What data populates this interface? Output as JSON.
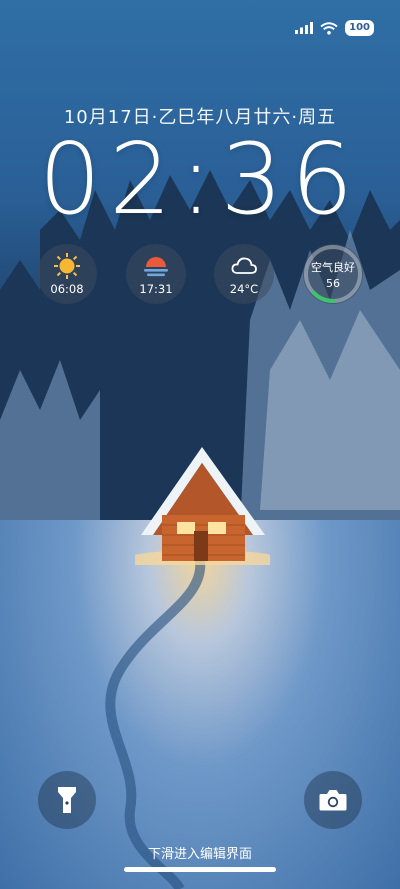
{
  "status_bar": {
    "signal_icon": "signal-icon",
    "wifi_icon": "wifi-icon",
    "battery": "100"
  },
  "lock_screen": {
    "date": "10月17日·乙巳年八月廿六·周五",
    "time": "02:36"
  },
  "widgets": {
    "sunrise": {
      "icon": "sun-icon",
      "value": "06:08"
    },
    "sunset": {
      "icon": "sunset-icon",
      "value": "17:31"
    },
    "weather": {
      "icon": "cloud-icon",
      "value": "24°C"
    },
    "air_quality": {
      "label": "空气良好",
      "value": "56",
      "ring_accent": "#3ec46d"
    }
  },
  "actions": {
    "flashlight_icon": "flashlight-icon",
    "camera_icon": "camera-icon"
  },
  "hint": "下滑进入编辑界面"
}
